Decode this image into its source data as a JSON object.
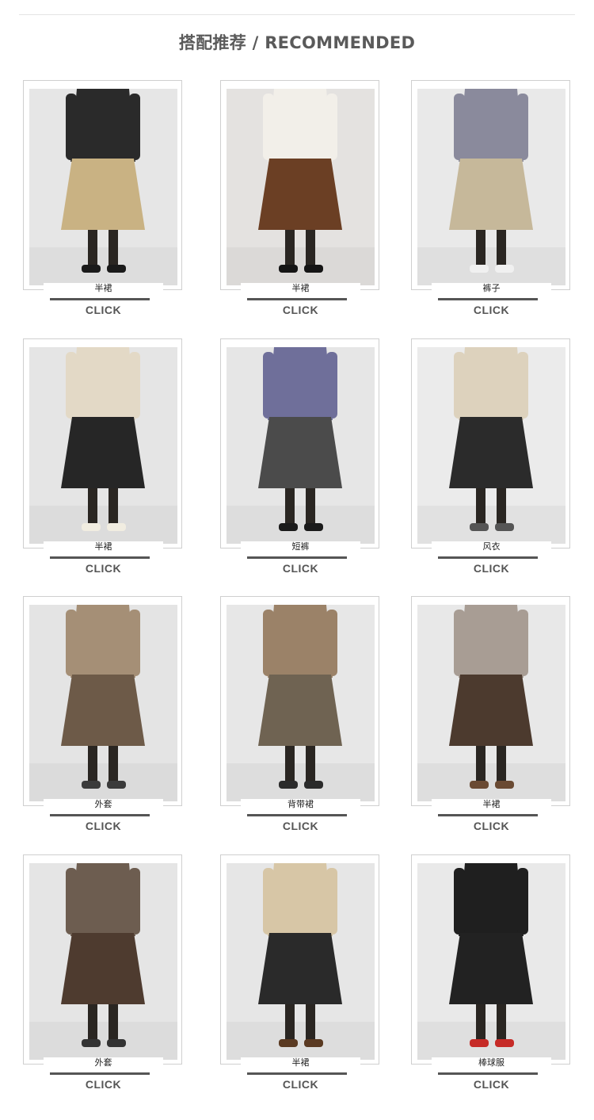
{
  "heading": "搭配推荐 / RECOMMENDED",
  "cta": "CLICK",
  "products": [
    {
      "label": "半裙",
      "image": "plaid-midi-skirt",
      "bg": "#e6e6e6",
      "top": "#2a2a2a",
      "bottom": "#c9b283",
      "shoes": "#1a1a1a"
    },
    {
      "label": "半裙",
      "image": "brown-corduroy-skirt",
      "bg": "#e4e2e0",
      "top": "#f2efe9",
      "bottom": "#6b3f24",
      "shoes": "#151515"
    },
    {
      "label": "裤子",
      "image": "khaki-wide-trousers",
      "bg": "#e9e9e9",
      "top": "#8a8a9c",
      "bottom": "#c6b89a",
      "shoes": "#f0f0f0"
    },
    {
      "label": "半裙",
      "image": "black-mini-skirt-coat",
      "bg": "#e5e5e5",
      "top": "#e3d9c6",
      "bottom": "#262626",
      "shoes": "#f1ede1"
    },
    {
      "label": "短裤",
      "image": "grey-shorts-boots",
      "bg": "#e6e6e6",
      "top": "#6f6f9a",
      "bottom": "#4b4b4b",
      "shoes": "#1b1b1b"
    },
    {
      "label": "风衣",
      "image": "beige-trench-coat",
      "bg": "#ebebeb",
      "top": "#ddd2bd",
      "bottom": "#2b2b2b",
      "shoes": "#555555"
    },
    {
      "label": "外套",
      "image": "tweed-jacket-beret",
      "bg": "#e4e4e4",
      "top": "#a58f76",
      "bottom": "#6d5a48",
      "shoes": "#3b3b3b"
    },
    {
      "label": "背带裙",
      "image": "pinafore-dress",
      "bg": "#e7e7e7",
      "top": "#9b8268",
      "bottom": "#6f6352",
      "shoes": "#2b2b2b"
    },
    {
      "label": "半裙",
      "image": "pleated-brown-skirt",
      "bg": "#e8e8e8",
      "top": "#a89d94",
      "bottom": "#4c3a2e",
      "shoes": "#6a4a33"
    },
    {
      "label": "外套",
      "image": "wool-toggle-coat",
      "bg": "#e5e5e5",
      "top": "#6d5d50",
      "bottom": "#4e3b2f",
      "shoes": "#333333"
    },
    {
      "label": "半裙",
      "image": "knit-top-pleat-skirt",
      "bg": "#e6e6e6",
      "top": "#d7c6a6",
      "bottom": "#2a2a2a",
      "shoes": "#5a3a22"
    },
    {
      "label": "棒球服",
      "image": "varsity-jacket-beret",
      "bg": "#e9e9e9",
      "top": "#1f1f1f",
      "bottom": "#222222",
      "shoes": "#c62b27"
    }
  ]
}
